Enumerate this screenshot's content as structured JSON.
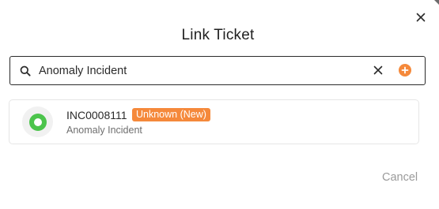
{
  "dialog": {
    "title": "Link Ticket",
    "cancel_label": "Cancel"
  },
  "search": {
    "value": "Anomaly Incident",
    "placeholder": ""
  },
  "results": [
    {
      "id": "INC0008111",
      "status": "Unknown (New)",
      "title": "Anomaly Incident"
    }
  ],
  "colors": {
    "accent": "#f5893b",
    "avatar_green": "#4cc44c",
    "border_dark": "#2a2a2a"
  },
  "icons": {
    "close": "close-icon",
    "search": "search-icon",
    "clear": "clear-icon",
    "add": "plus-circle-icon",
    "avatar": "avatar-icon"
  }
}
